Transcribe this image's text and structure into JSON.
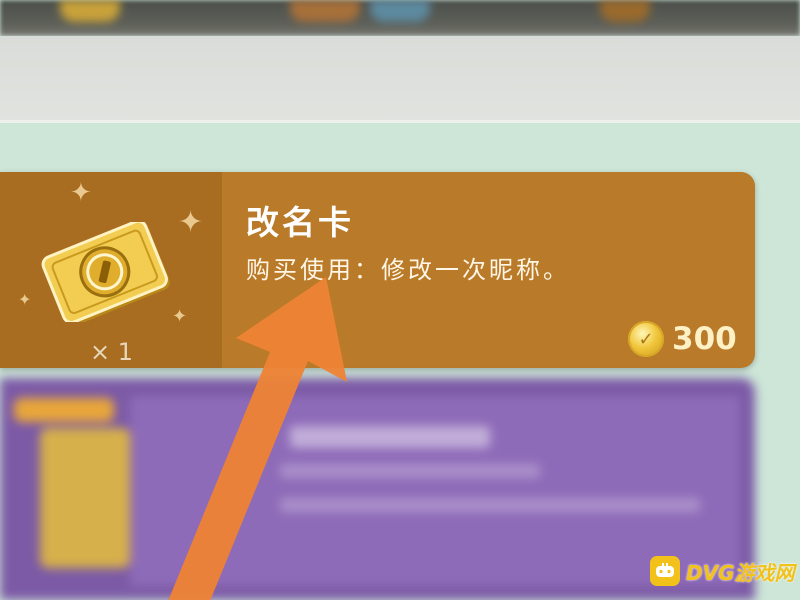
{
  "card": {
    "title": "改名卡",
    "description": "购买使用：修改一次昵称。",
    "quantity": "× 1",
    "price": "300",
    "colors": {
      "card": "#b97a29",
      "title": "#ffffff",
      "price": "#fff1c6"
    }
  },
  "icons": {
    "item": "rename-card-icon",
    "currency": "coin-icon",
    "arrow": "orange-arrow-annotation"
  },
  "watermark": {
    "text": "DVG游戏网"
  }
}
